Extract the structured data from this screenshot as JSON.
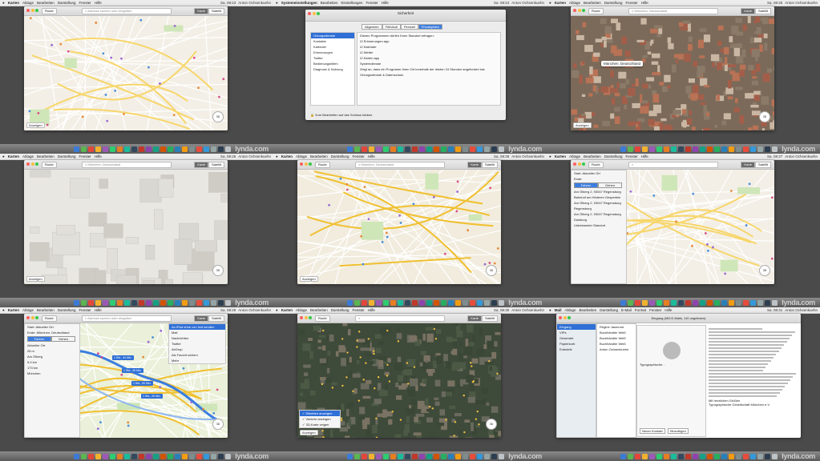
{
  "brand": "lynda.com",
  "dock_colors": [
    "#3a7bd5",
    "#5ab552",
    "#e3463a",
    "#f2b230",
    "#9b59b6",
    "#2ecc71",
    "#e67e22",
    "#1abc9c",
    "#34495e",
    "#c0392b",
    "#8e44ad",
    "#16a085",
    "#d35400",
    "#27ae60",
    "#2980b9",
    "#f39c12",
    "#7f8c8d",
    "#e74c3c",
    "#3498db",
    "#95a5a6",
    "#2c3e50",
    "#bdc3c7",
    "#f1c40f",
    "#6c5ce7"
  ],
  "tiles": [
    {
      "menu": {
        "app": "Karten",
        "items": [
          "Ablage",
          "Bearbeiten",
          "Darstellung",
          "Fenster",
          "Hilfe"
        ],
        "right": "Sa. 08:23",
        "user": "Anton Ochsenkuehn"
      },
      "toolbar": {
        "route": "Route",
        "search": "Adresse suchen oder eingeben",
        "seg": [
          "Karte",
          "Satellit"
        ]
      },
      "anz": "Anzeigen",
      "map": "light"
    },
    {
      "menu": {
        "app": "Systemeinstellungen",
        "items": [
          "Bearbeiten",
          "Einstellungen",
          "Fenster",
          "Hilfe"
        ],
        "right": "Sa. 08:24",
        "user": "Anton Ochsenkuehn"
      },
      "prefs": {
        "title": "Sicherheit",
        "tabs": [
          "Allgemein",
          "FileVault",
          "Firewall",
          "Privatsphäre"
        ],
        "list": [
          "Ortungsdienste",
          "Kontakte",
          "Kalender",
          "Erinnerungen",
          "Twitter",
          "Bedienungshilfen",
          "Diagnose & Nutzung"
        ],
        "heading": "Diesen Programmen dürfen Ihren Standort erfragen:",
        "apps": [
          "Erinnerungen.app",
          "Kalender",
          "Wetter",
          "Karten.app"
        ],
        "sys": "Systemdienste",
        "note": "Zeigt an, dass ein Programm Ihren Ort innerhalb der letzten 24 Stunden angefordert hat.",
        "btn": "Ortungsdienste & Datenschutz",
        "lock": "Zum Bearbeiten auf das Schloss klicken."
      }
    },
    {
      "menu": {
        "app": "Karten",
        "items": [
          "Ablage",
          "Bearbeiten",
          "Darstellung",
          "Fenster",
          "Hilfe"
        ],
        "right": "Sa. 08:25",
        "user": "Anton Ochsenkuehn"
      },
      "toolbar": {
        "route": "Route",
        "search": "München, Deutschland",
        "seg": [
          "Karte",
          "Satellit"
        ]
      },
      "anz": "Anzeigen",
      "map": "aerial",
      "pin": "München, Deutschland"
    },
    {
      "menu": {
        "app": "Karten",
        "items": [
          "Ablage",
          "Bearbeiten",
          "Darstellung",
          "Fenster",
          "Hilfe"
        ],
        "right": "Sa. 08:26",
        "user": "Anton Ochsenkuehn"
      },
      "toolbar": {
        "route": "Route",
        "search": "München, Deutschland",
        "seg": [
          "Karte",
          "Satellit"
        ]
      },
      "anz": "Anzeigen",
      "map": "3d"
    },
    {
      "menu": {
        "app": "Karten",
        "items": [
          "Ablage",
          "Bearbeiten",
          "Darstellung",
          "Fenster",
          "Hilfe"
        ],
        "right": "Sa. 08:28",
        "user": "Anton Ochsenkuehn"
      },
      "toolbar": {
        "route": "Route",
        "search": "München, Deutschland",
        "seg": [
          "Karte",
          "Satellit"
        ]
      },
      "anz": "Anzeigen",
      "map": "city"
    },
    {
      "menu": {
        "app": "Karten",
        "items": [
          "Ablage",
          "Bearbeiten",
          "Darstellung",
          "Fenster",
          "Hilfe"
        ],
        "right": "Sa. 08:27",
        "user": "Anton Ochsenkuehn"
      },
      "toolbar": {
        "route": "Route",
        "search": "",
        "seg": [
          "Karte",
          "Satellit"
        ]
      },
      "anz": "Anzeigen",
      "map": "light",
      "route": {
        "from": "Start: Aktueller Ort",
        "to": "Ende:",
        "modes": [
          "Fahren",
          "Gehen"
        ],
        "items": [
          "Am Ölberg 2, 93047 Regensburg",
          "Bahnhof am Hinteren Gesperlein",
          "Am Ölberg 2, 93047 Regensburg",
          "Regensburg",
          "Am Ölberg 2, 93047 Regensburg",
          "Duisburg",
          "Unbekannter Standort"
        ]
      }
    },
    {
      "menu": {
        "app": "Karten",
        "items": [
          "Ablage",
          "Bearbeiten",
          "Darstellung",
          "Fenster",
          "Hilfe"
        ],
        "right": "Sa. 08:29",
        "user": "Anton Ochsenkuehn"
      },
      "toolbar": {
        "route": "Route",
        "search": "Adresse suchen oder eingeben",
        "seg": [
          "Karte",
          "Satellit"
        ]
      },
      "anz": "Anzeigen",
      "map": "route",
      "route": {
        "from": "Start: Aktueller Ort",
        "to": "Ende: München, Deutschland",
        "modes": [
          "Fahren",
          "Gehen"
        ],
        "steps": [
          "Aktueller Ort",
          "28 m",
          "Am Ölberg",
          "9,4 km",
          "173 km",
          "München"
        ]
      },
      "share": {
        "title": "An iPad ohne von Isnt senden",
        "items": [
          "Mail",
          "Nachrichten",
          "Twitter",
          "AirDrop",
          "Als Favorit sichern",
          "Mehr"
        ]
      },
      "bubbles": [
        "1 Std., 44 Min.",
        "1 Std., 49 Min.",
        "1 Std., 50 Min.",
        "1 Std., 26 Min."
      ]
    },
    {
      "menu": {
        "app": "Karten",
        "items": [
          "Ablage",
          "Bearbeiten",
          "Darstellung",
          "Fenster",
          "Hilfe"
        ],
        "right": "Sa. 08:30",
        "user": "Anton Ochsenkuehn"
      },
      "toolbar": {
        "route": "Route",
        "search": "",
        "seg": [
          "Karte",
          "Satellit"
        ]
      },
      "anz": "Anzeigen",
      "map": "sat",
      "popup": [
        "Etiketten anzeigen",
        "Verkehr anzeigen",
        "3D-Karte zeigen"
      ]
    },
    {
      "menu": {
        "app": "Mail",
        "items": [
          "Ablage",
          "Bearbeiten",
          "Darstellung",
          "E-Mail",
          "Format",
          "Fenster",
          "Hilfe"
        ],
        "right": "Sa. 08:31",
        "user": "Anton Ochsenkuehn"
      },
      "mail": {
        "title": "Eingang (653 E-Mails, 110 ungelesen)",
        "boxes": [
          "Eingang",
          "VIPs",
          "Gesendet",
          "Papierkorb",
          "Entwürfe"
        ],
        "card": "Typographische...",
        "senders": [
          "Regine Jasmund",
          "Buchhändler Weiß",
          "Buchhändler Weiß",
          "Buchhändler Weiß",
          "Anton Ochsenkuehn"
        ],
        "sig": "Mit herzlichen Grüßen",
        "company": "Typographische Gesellschaft München e.V.",
        "btns": [
          "Neuer Kontakt",
          "Hinzufügen"
        ]
      }
    }
  ]
}
